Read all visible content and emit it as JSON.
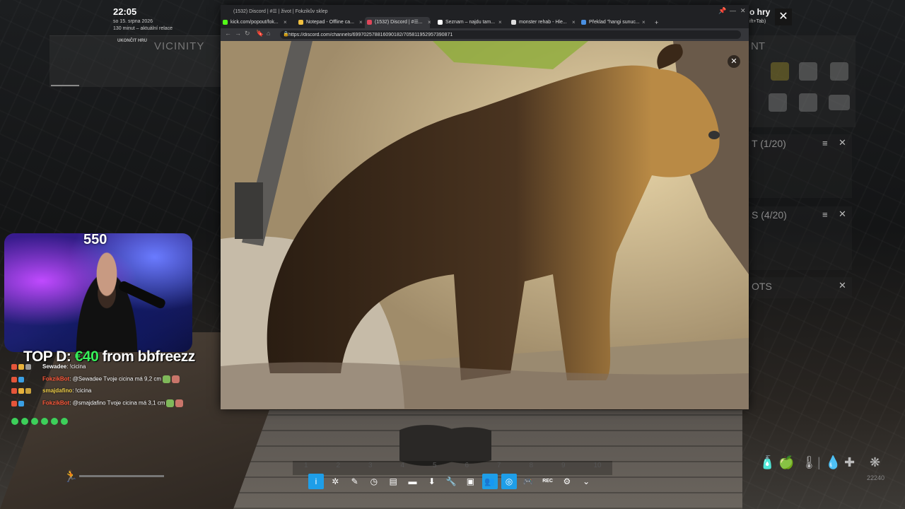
{
  "game": {
    "clock": "22:05",
    "date": "so 15. srpna 2026",
    "session": "130 minut – aktuální relace",
    "end_game": "UKONČIT HRU",
    "vicinity_title": "VICINITY",
    "equipment_title": "NT",
    "menu_label": "o hry",
    "shortcut": "ift+Tab)",
    "inventory": [
      {
        "title": "T (1/20)",
        "sort": "≡",
        "close": "✕"
      },
      {
        "title": "S (4/20)",
        "sort": "≡",
        "close": "✕"
      },
      {
        "title": "OTS",
        "close": "✕"
      }
    ],
    "close_overlay": "✕",
    "stat_number": "22240",
    "stat_icons": [
      "bottle-icon",
      "food-icon",
      "thermometer-icon",
      "separator",
      "water-drop-icon",
      "health-cross-icon",
      "virus-icon"
    ],
    "hotbar_slots": [
      "1",
      "2",
      "3",
      "4",
      "5",
      "6",
      "7",
      "8",
      "9",
      "10"
    ]
  },
  "stream": {
    "sub_count": "550",
    "top_donation_prefix": "TOP D: ",
    "top_donation_amount": "€40",
    "top_donation_suffix": " from bbfreezz",
    "chat": [
      {
        "user": "Sewadee",
        "text": ": !cicina",
        "user_color": "#ffffff",
        "badges": [
          "#e5553a",
          "#e8b23c",
          "#9a9a9a"
        ],
        "emotes": []
      },
      {
        "user": "FokzikBot",
        "text": ": @Sewadee Tvoje cicina má 9,2 cm",
        "user_color": "#ff5a3c",
        "badges": [
          "#e5553a",
          "#3aa0e5"
        ],
        "emotes": [
          "#7fb85a",
          "#c9756a"
        ]
      },
      {
        "user": "smajdafino",
        "text": ": !cicina",
        "user_color": "#f0d04a",
        "badges": [
          "#e5553a",
          "#e8b23c",
          "#c9a03c"
        ],
        "emotes": []
      },
      {
        "user": "FokzikBot",
        "text": ": @smajdafino Tvoje cicina má 3,1 cm",
        "user_color": "#ff5a3c",
        "badges": [
          "#e5553a",
          "#3aa0e5"
        ],
        "emotes": [
          "#7fb85a",
          "#c9756a"
        ]
      }
    ]
  },
  "browser": {
    "window_title": "(1532) Discord | #☰ | život | Fokzikův sklep",
    "url": "https://discord.com/channels/699702578816090182/705811952957390871",
    "tabs": [
      {
        "label": "kick.com/popout/fok...",
        "active": false,
        "favicon": "#53fc18"
      },
      {
        "label": "Notepad - Offline ca...",
        "active": false,
        "favicon": "#f0c040"
      },
      {
        "label": "(1532) Discord | #☰...",
        "active": true,
        "favicon": "#e0475a"
      },
      {
        "label": "Seznam – najdu tam...",
        "active": false,
        "favicon": "#ffffff"
      },
      {
        "label": "monster rehab - Hle...",
        "active": false,
        "favicon": "#dddddd"
      },
      {
        "label": "Překlad \"hangi sunuc...",
        "active": false,
        "favicon": "#4a90e2"
      }
    ],
    "image_close": "✕"
  },
  "overlay_toolbar": [
    {
      "name": "info",
      "glyph": "i",
      "on": true
    },
    {
      "name": "achievements",
      "glyph": "✲",
      "on": false
    },
    {
      "name": "pencil",
      "glyph": "✎",
      "on": false
    },
    {
      "name": "clock",
      "glyph": "◷",
      "on": false
    },
    {
      "name": "notes",
      "glyph": "▤",
      "on": false
    },
    {
      "name": "chat",
      "glyph": "▬",
      "on": false
    },
    {
      "name": "download",
      "glyph": "⬇",
      "on": false
    },
    {
      "name": "wrench",
      "glyph": "🔧",
      "on": false
    },
    {
      "name": "screenshot",
      "glyph": "▣",
      "on": false
    },
    {
      "name": "friends",
      "glyph": "👥",
      "on": true
    },
    {
      "name": "browser",
      "glyph": "◎",
      "on": true
    },
    {
      "name": "controller",
      "glyph": "🎮",
      "on": false
    },
    {
      "name": "record",
      "glyph": "REC",
      "on": false
    },
    {
      "name": "settings",
      "glyph": "⚙",
      "on": false
    },
    {
      "name": "minimize",
      "glyph": "⌄",
      "on": false
    }
  ]
}
